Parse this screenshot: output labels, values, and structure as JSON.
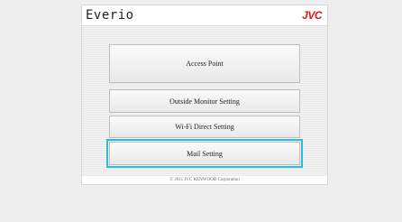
{
  "header": {
    "brand": "Everio",
    "logo": "JVC",
    "logo_color": "#d41c1c"
  },
  "menu": {
    "access_point": "Access Point",
    "outside_monitor_setting": "Outside Monitor Setting",
    "wifi_direct_setting": "Wi-Fi Direct Setting",
    "mail_setting": "Mail Setting",
    "selected": "Mail Setting",
    "focus_color": "#33b8d6"
  },
  "footer": {
    "copyright": "© 2011 JVC KENWOOD Corporation"
  }
}
